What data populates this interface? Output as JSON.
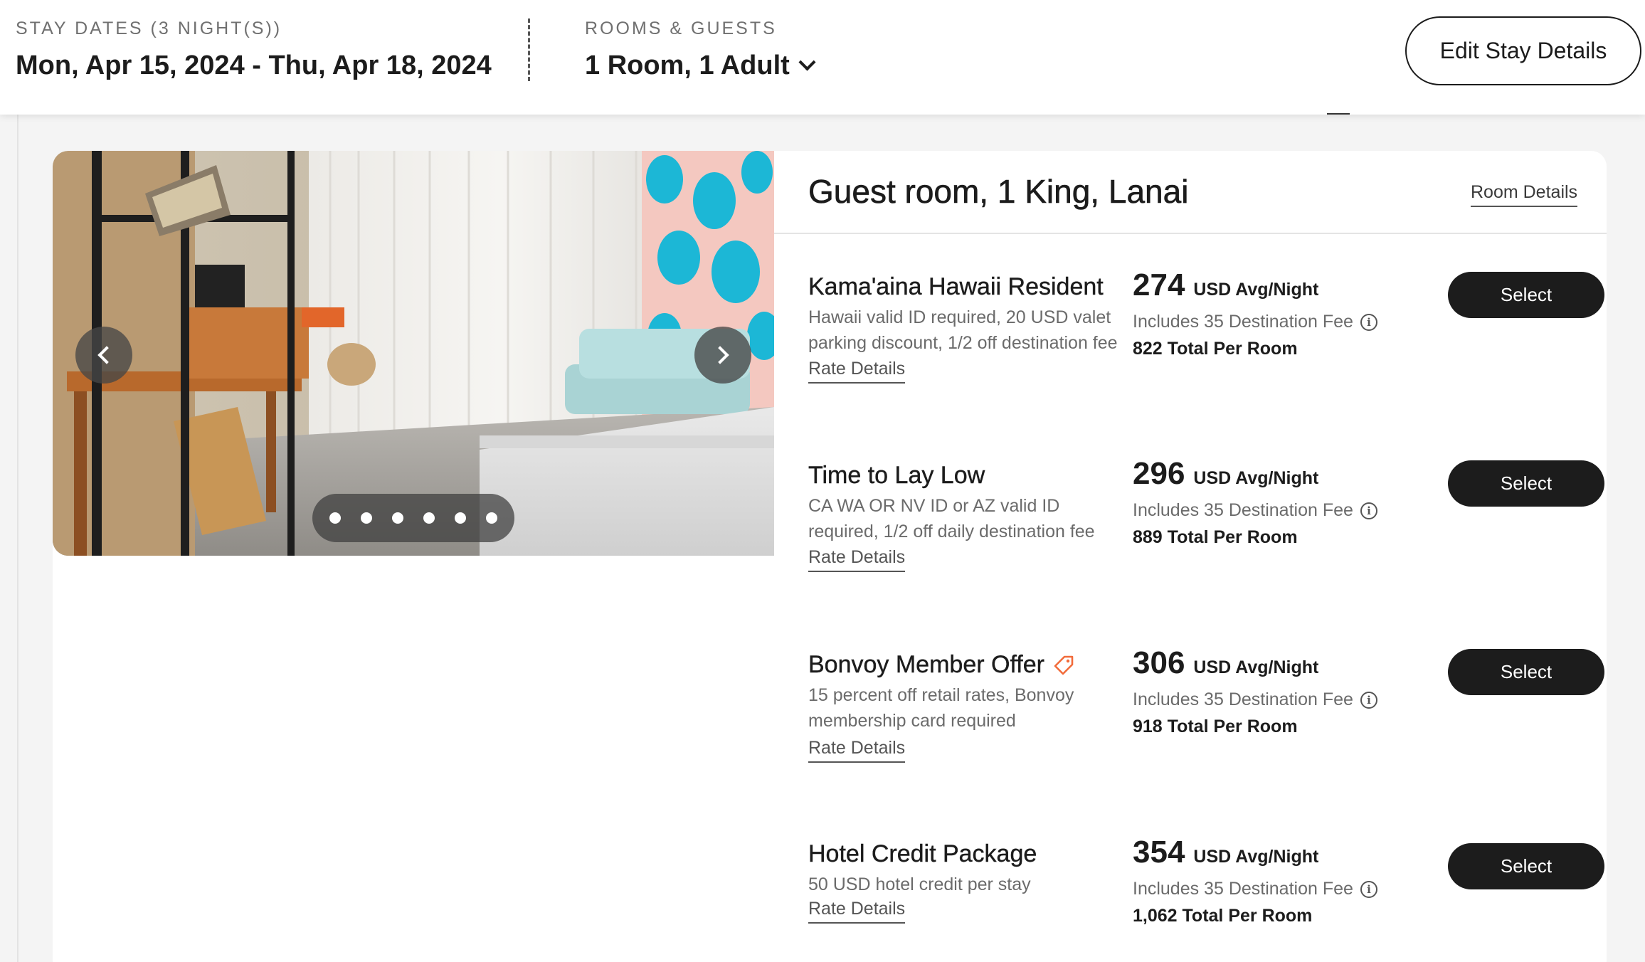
{
  "header": {
    "stay_label": "STAY DATES (3 NIGHT(S))",
    "stay_dates": "Mon, Apr 15, 2024 - Thu, Apr 18, 2024",
    "rooms_label": "ROOMS & GUESTS",
    "rooms_value": "1 Room, 1 Adult",
    "edit_button": "Edit Stay Details"
  },
  "room": {
    "title": "Guest room, 1 King, Lanai",
    "details_link": "Room Details",
    "carousel": {
      "slide_count": 6,
      "prev_icon": "chevron-left-icon",
      "next_icon": "chevron-right-icon"
    }
  },
  "rates": [
    {
      "name": "Kama'aina Hawaii Resident",
      "description": "Hawaii valid ID required, 20 USD valet parking discount, 1/2 off destination fee",
      "link": "Rate Details",
      "price": "274",
      "unit": "USD Avg/Night",
      "fee": "Includes 35 Destination Fee",
      "total": "822 Total Per Room",
      "button": "Select"
    },
    {
      "name": "Time to Lay Low",
      "description": "CA WA OR NV ID or AZ valid ID required, 1/2 off daily destination fee",
      "link": "Rate Details",
      "price": "296",
      "unit": "USD Avg/Night",
      "fee": "Includes 35 Destination Fee",
      "total": "889 Total Per Room",
      "button": "Select"
    },
    {
      "name": "Bonvoy Member Offer",
      "description": "15 percent off retail rates, Bonvoy membership card required",
      "link": "Rate Details",
      "price": "306",
      "unit": "USD Avg/Night",
      "fee": "Includes 35 Destination Fee",
      "total": "918 Total Per Room",
      "button": "Select",
      "badge_icon": "member-tag-icon",
      "badge_color": "#f26b3a"
    },
    {
      "name": "Hotel Credit Package",
      "description": "50 USD hotel credit per stay",
      "link": "Rate Details",
      "price": "354",
      "unit": "USD Avg/Night",
      "fee": "Includes 35 Destination Fee",
      "total": "1,062 Total Per Room",
      "button": "Select"
    }
  ],
  "colors": {
    "primary_button": "#1c1c1c",
    "accent": "#f26b3a"
  }
}
